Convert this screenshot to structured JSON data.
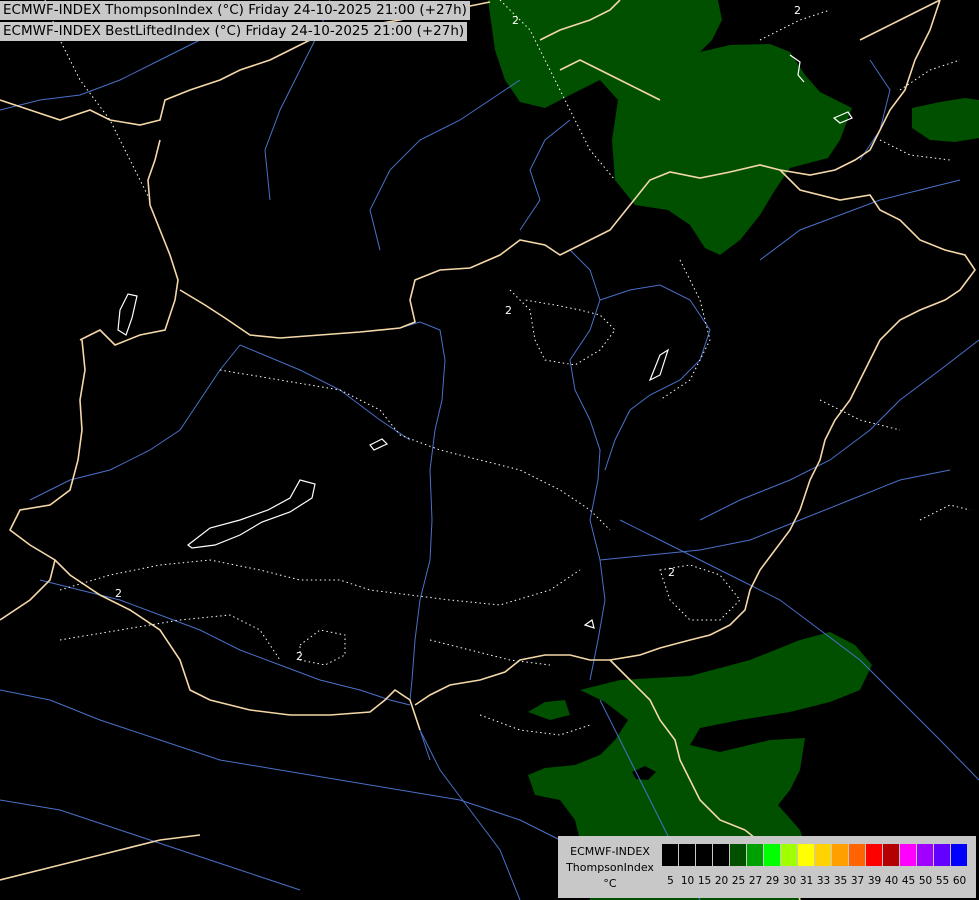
{
  "titles": {
    "line1": "ECMWF-INDEX ThompsonIndex (°C) Friday 24-10-2025 21:00 (+27h)",
    "line2": "ECMWF-INDEX BestLiftedIndex (°C) Friday 24-10-2025 21:00 (+27h)"
  },
  "legend": {
    "model": "ECMWF-INDEX",
    "parameter": "ThompsonIndex",
    "unit": "°C",
    "levels": [
      "5",
      "10",
      "15",
      "20",
      "25",
      "27",
      "29",
      "30",
      "31",
      "33",
      "35",
      "37",
      "39",
      "40",
      "45",
      "50",
      "55",
      "60"
    ],
    "colors": [
      "#000000",
      "#000000",
      "#000000",
      "#000000",
      "#005000",
      "#00a000",
      "#00ff00",
      "#a0ff00",
      "#ffff00",
      "#ffd200",
      "#ffa000",
      "#ff6400",
      "#ff0000",
      "#b40000",
      "#ff00ff",
      "#a000ff",
      "#6400ff",
      "#0000ff"
    ]
  },
  "contour_labels": [
    "2",
    "2",
    "2",
    "2",
    "2",
    "2"
  ],
  "colors": {
    "background": "#000000",
    "thompson_fill": "#005000",
    "borders": "#f5d8a8",
    "rivers": "#4a70c8",
    "contours": "#ffffff",
    "title_bg": "#c8c8c8"
  }
}
